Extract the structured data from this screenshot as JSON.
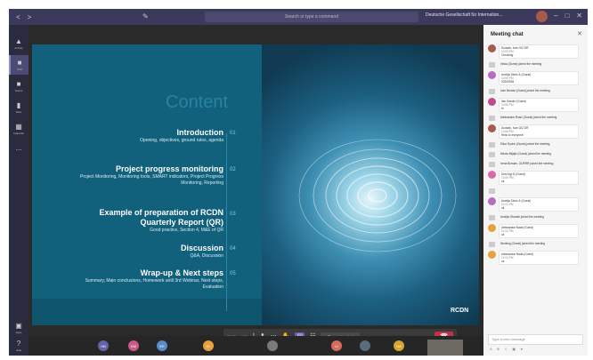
{
  "titlebar": {
    "back": "<",
    "forward": ">",
    "edit_icon": "edit-icon",
    "search_placeholder": "Search or type a command",
    "org_name": "Deutsche Gesellschaft für Internation...",
    "window_controls": [
      "–",
      "□",
      "✕"
    ]
  },
  "rail": {
    "items": [
      {
        "label": "Activity",
        "icon": "bell-icon"
      },
      {
        "label": "Chat",
        "icon": "chat-icon"
      },
      {
        "label": "Teams",
        "icon": "teams-icon"
      },
      {
        "label": "Files",
        "icon": "files-icon"
      },
      {
        "label": "Calendar",
        "icon": "calendar-icon"
      },
      {
        "label": "...",
        "icon": "more-icon"
      }
    ],
    "bottom": [
      {
        "label": "Apps",
        "icon": "apps-icon"
      },
      {
        "label": "Help",
        "icon": "help-icon"
      }
    ]
  },
  "slide": {
    "title": "Content",
    "agenda": [
      {
        "heading": "Introduction",
        "detail": "Opening, objectives, ground rules, agenda",
        "num": "01"
      },
      {
        "heading": "Project progress monitoring",
        "detail": "Project Monitoring, Monitoring tools, SMART indicators, Project Progress Monitoring, Reporting",
        "num": "02"
      },
      {
        "heading": "Example of preparation of RCDN Quarterly Report (QR)",
        "detail": "Good practice, Section 4, M&E of QR",
        "num": "03"
      },
      {
        "heading": "Discussion",
        "detail": "Q&A, Discussion",
        "num": "04"
      },
      {
        "heading": "Wrap-up & Next steps",
        "detail": "Summary, Main conclusions, Homework until 3rd Webinar, Next steps, Evaluation",
        "num": "05"
      }
    ],
    "logo": "RCDN"
  },
  "meeting": {
    "presenter_label": "Dudarik, Ivan GIZ DR",
    "toolbar": {
      "timer": "23:00",
      "request_control": "Request control",
      "icons": [
        "camera-icon",
        "mic-icon",
        "share-icon",
        "more-icon",
        "raise-hand-icon",
        "chat-icon",
        "participants-icon"
      ],
      "hangup": "hang-up-icon"
    },
    "participants": [
      {
        "initials": "HB",
        "color": "#6264a7"
      },
      {
        "initials": "EM",
        "color": "#c85a8a"
      },
      {
        "initials": "EE",
        "color": "#5a8ac8"
      },
      {
        "initials": "IK",
        "color": "#e6a23c"
      },
      {
        "initials": "",
        "color": "#7a7a7a"
      },
      {
        "initials": "LI",
        "color": "#d86c5b"
      },
      {
        "initials": "",
        "color": "#5b6d7a"
      },
      {
        "initials": "DA",
        "color": "#d4a72c"
      }
    ]
  },
  "chat": {
    "title": "Meeting chat",
    "messages": [
      {
        "name": "Dudarik, Ivan GIZ DR",
        "time": "10:53 PM",
        "text": "Checking",
        "av": "#a85b4c",
        "system": false
      },
      {
        "name": "",
        "time": "",
        "text": "Irinka (Guest) joined the meeting",
        "av": "",
        "system": true
      },
      {
        "name": "Andrija Simic & (Guest)",
        "time": "10:55 PM",
        "text": "20200528",
        "av": "#b86cc0",
        "system": false
      },
      {
        "name": "",
        "time": "",
        "text": "Ivan Bendur (Guest) joined the meeting",
        "av": "",
        "system": true
      },
      {
        "name": "Ilan Sandro (Guest)",
        "time": "10:56 PM",
        "text": "hi",
        "av": "#c34a8a",
        "system": false
      },
      {
        "name": "",
        "time": "",
        "text": "Aleksandar Rosić (Guest) joined the meeting",
        "av": "",
        "system": true
      },
      {
        "name": "Dudarik, Ivan GIZ DR",
        "time": "10:58 PM",
        "text": "Hello to everyone",
        "av": "#a85b4c",
        "system": false
      },
      {
        "name": "",
        "time": "",
        "text": "Elion Hydric (Guest) joined the meeting",
        "av": "",
        "system": true
      },
      {
        "name": "",
        "time": "",
        "text": "Nikola Mijajić (Guest) joined the meeting",
        "av": "",
        "system": true
      },
      {
        "name": "",
        "time": "",
        "text": "Irena Bursian, GURRR joined the meeting",
        "av": "",
        "system": true
      },
      {
        "name": "Dmz trgf.D (Guest)",
        "time": "10:59 PM",
        "text": "ok",
        "av": "#d86cab",
        "system": false
      },
      {
        "name": "",
        "time": "",
        "text": "",
        "av": "",
        "system": true
      },
      {
        "name": "Andrija Simic & (Guest)",
        "time": "11:01 PM",
        "text": "ok",
        "av": "#b86cc0",
        "system": false
      },
      {
        "name": "",
        "time": "",
        "text": "Andrija Obradić joined the meeting",
        "av": "",
        "system": true
      },
      {
        "name": "Aleksandar Nada (Guest)",
        "time": "11:02 PM",
        "text": "ok",
        "av": "#e6a23c",
        "system": false
      },
      {
        "name": "",
        "time": "",
        "text": "Working (Guest) joined the meeting",
        "av": "",
        "system": true
      },
      {
        "name": "Aleksandar Nada (Guest)",
        "time": "11:03 PM",
        "text": "ok",
        "av": "#e6a23c",
        "system": false
      }
    ],
    "compose_placeholder": "Type a new message"
  }
}
